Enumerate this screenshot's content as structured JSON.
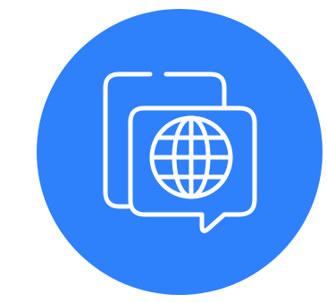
{
  "icon": {
    "name": "translate-globe-chat-icon",
    "background_color": "#2F80FB",
    "stroke_color": "#FFFFFF"
  }
}
